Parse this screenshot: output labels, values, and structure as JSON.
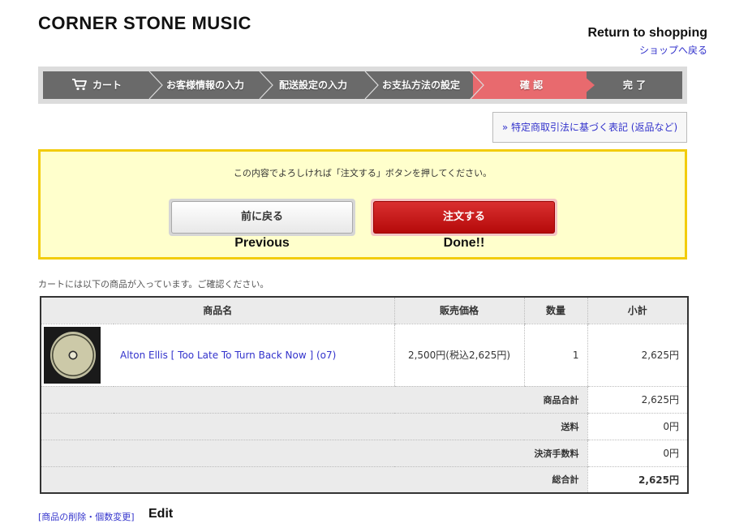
{
  "site": {
    "title": "CORNER STONE MUSIC",
    "return_en": "Return to shopping",
    "return_jp": "ショップへ戻る"
  },
  "steps": [
    {
      "label": "カート",
      "icon": "cart-icon",
      "active": false
    },
    {
      "label": "お客様情報の入力",
      "active": false
    },
    {
      "label": "配送設定の入力",
      "active": false
    },
    {
      "label": "お支払方法の設定",
      "active": false
    },
    {
      "label": "確 認",
      "active": true
    },
    {
      "label": "完 了",
      "active": false
    }
  ],
  "legal_link": "» 特定商取引法に基づく表記 (返品など)",
  "confirm": {
    "message": "この内容でよろしければ「注文する」ボタンを押してください。",
    "prev_button": "前に戻る",
    "prev_caption": "Previous",
    "order_button": "注文する",
    "order_caption": "Done!!"
  },
  "cart_note": "カートには以下の商品が入っています。ご確認ください。",
  "table": {
    "headers": {
      "name": "商品名",
      "price": "販売価格",
      "qty": "数量",
      "subtotal": "小計"
    },
    "items": [
      {
        "name": "Alton Ellis [ Too Late To Turn Back Now ] (o7)",
        "price": "2,500円(税込2,625円)",
        "qty": "1",
        "subtotal": "2,625円"
      }
    ],
    "summary": [
      {
        "label": "商品合計",
        "value": "2,625円"
      },
      {
        "label": "送料",
        "value": "0円"
      },
      {
        "label": "決済手数料",
        "value": "0円"
      },
      {
        "label": "総合計",
        "value": "2,625円"
      }
    ]
  },
  "edit": {
    "link": "[商品の削除・個数変更]",
    "caption": "Edit"
  },
  "colors": {
    "active_step": "#e86a6e",
    "step_bg": "#6a6a6a",
    "order_button": "#c41414",
    "confirm_bg": "#ffffcc",
    "confirm_border": "#f2cc0c",
    "link": "#3333cc"
  }
}
